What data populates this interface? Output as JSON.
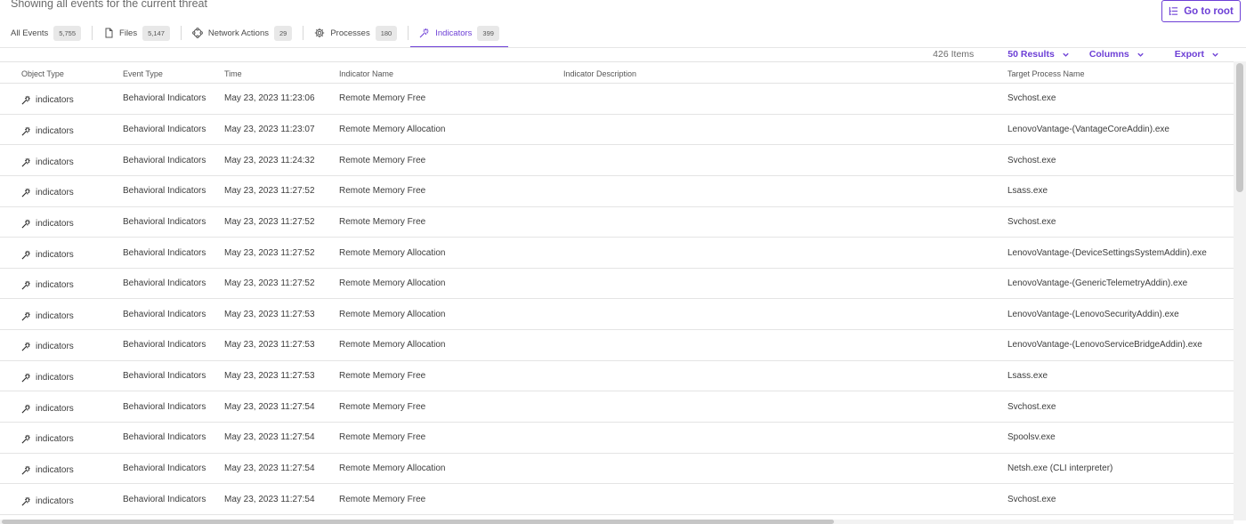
{
  "header": {
    "subtitle": "Showing all events for the current threat",
    "go_root_label": "Go to root"
  },
  "tabs": [
    {
      "label": "All Events",
      "count": "5,755",
      "icon": "none"
    },
    {
      "label": "Files",
      "count": "5,147",
      "icon": "file-icon"
    },
    {
      "label": "Network Actions",
      "count": "29",
      "icon": "network-icon"
    },
    {
      "label": "Processes",
      "count": "180",
      "icon": "gear-icon"
    },
    {
      "label": "Indicators",
      "count": "399",
      "icon": "indicator-icon",
      "active": true
    }
  ],
  "toolbar": {
    "items_count": "426 Items",
    "results_label": "50 Results",
    "columns_label": "Columns",
    "export_label": "Export"
  },
  "table": {
    "columns": [
      "Object Type",
      "Event Type",
      "Time",
      "Indicator Name",
      "Indicator Description",
      "Target Process Name"
    ],
    "rows": [
      {
        "object_type": "indicators",
        "event_type": "Behavioral Indicators",
        "time": "May 23, 2023 11:23:06",
        "indicator_name": "Remote Memory Free",
        "indicator_description": "",
        "target_process": "Svchost.exe"
      },
      {
        "object_type": "indicators",
        "event_type": "Behavioral Indicators",
        "time": "May 23, 2023 11:23:07",
        "indicator_name": "Remote Memory Allocation",
        "indicator_description": "",
        "target_process": "LenovoVantage-(VantageCoreAddin).exe"
      },
      {
        "object_type": "indicators",
        "event_type": "Behavioral Indicators",
        "time": "May 23, 2023 11:24:32",
        "indicator_name": "Remote Memory Free",
        "indicator_description": "",
        "target_process": "Svchost.exe"
      },
      {
        "object_type": "indicators",
        "event_type": "Behavioral Indicators",
        "time": "May 23, 2023 11:27:52",
        "indicator_name": "Remote Memory Free",
        "indicator_description": "",
        "target_process": "Lsass.exe"
      },
      {
        "object_type": "indicators",
        "event_type": "Behavioral Indicators",
        "time": "May 23, 2023 11:27:52",
        "indicator_name": "Remote Memory Free",
        "indicator_description": "",
        "target_process": "Svchost.exe"
      },
      {
        "object_type": "indicators",
        "event_type": "Behavioral Indicators",
        "time": "May 23, 2023 11:27:52",
        "indicator_name": "Remote Memory Allocation",
        "indicator_description": "",
        "target_process": "LenovoVantage-(DeviceSettingsSystemAddin).exe"
      },
      {
        "object_type": "indicators",
        "event_type": "Behavioral Indicators",
        "time": "May 23, 2023 11:27:52",
        "indicator_name": "Remote Memory Allocation",
        "indicator_description": "",
        "target_process": "LenovoVantage-(GenericTelemetryAddin).exe"
      },
      {
        "object_type": "indicators",
        "event_type": "Behavioral Indicators",
        "time": "May 23, 2023 11:27:53",
        "indicator_name": "Remote Memory Allocation",
        "indicator_description": "",
        "target_process": "LenovoVantage-(LenovoSecurityAddin).exe"
      },
      {
        "object_type": "indicators",
        "event_type": "Behavioral Indicators",
        "time": "May 23, 2023 11:27:53",
        "indicator_name": "Remote Memory Allocation",
        "indicator_description": "",
        "target_process": "LenovoVantage-(LenovoServiceBridgeAddin).exe"
      },
      {
        "object_type": "indicators",
        "event_type": "Behavioral Indicators",
        "time": "May 23, 2023 11:27:53",
        "indicator_name": "Remote Memory Free",
        "indicator_description": "",
        "target_process": "Lsass.exe"
      },
      {
        "object_type": "indicators",
        "event_type": "Behavioral Indicators",
        "time": "May 23, 2023 11:27:54",
        "indicator_name": "Remote Memory Free",
        "indicator_description": "",
        "target_process": "Svchost.exe"
      },
      {
        "object_type": "indicators",
        "event_type": "Behavioral Indicators",
        "time": "May 23, 2023 11:27:54",
        "indicator_name": "Remote Memory Free",
        "indicator_description": "",
        "target_process": "Spoolsv.exe"
      },
      {
        "object_type": "indicators",
        "event_type": "Behavioral Indicators",
        "time": "May 23, 2023 11:27:54",
        "indicator_name": "Remote Memory Allocation",
        "indicator_description": "",
        "target_process": "Netsh.exe (CLI interpreter)"
      },
      {
        "object_type": "indicators",
        "event_type": "Behavioral Indicators",
        "time": "May 23, 2023 11:27:54",
        "indicator_name": "Remote Memory Free",
        "indicator_description": "",
        "target_process": "Svchost.exe"
      }
    ]
  },
  "colors": {
    "accent": "#6d3fd6",
    "badge_bg": "#e8e8e8",
    "row_border": "#e4e4e4"
  }
}
